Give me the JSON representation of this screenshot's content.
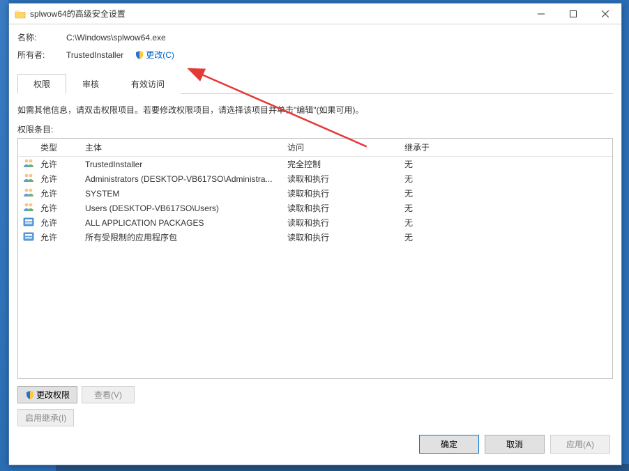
{
  "window": {
    "title": "splwow64的高级安全设置"
  },
  "info": {
    "name_label": "名称:",
    "name_value": "C:\\Windows\\splwow64.exe",
    "owner_label": "所有者:",
    "owner_value": "TrustedInstaller",
    "change_link": "更改(C)"
  },
  "tabs": [
    "权限",
    "审核",
    "有效访问"
  ],
  "instruction": "如需其他信息，请双击权限项目。若要修改权限项目，请选择该项目并单击\"编辑\"(如果可用)。",
  "entries_label": "权限条目:",
  "columns": {
    "type": "类型",
    "principal": "主体",
    "access": "访问",
    "inherit": "继承于"
  },
  "rows": [
    {
      "icon": "users",
      "type": "允许",
      "principal": "TrustedInstaller",
      "access": "完全控制",
      "inherit": "无"
    },
    {
      "icon": "users",
      "type": "允许",
      "principal": "Administrators (DESKTOP-VB617SO\\Administra...",
      "access": "读取和执行",
      "inherit": "无"
    },
    {
      "icon": "users",
      "type": "允许",
      "principal": "SYSTEM",
      "access": "读取和执行",
      "inherit": "无"
    },
    {
      "icon": "users",
      "type": "允许",
      "principal": "Users (DESKTOP-VB617SO\\Users)",
      "access": "读取和执行",
      "inherit": "无"
    },
    {
      "icon": "package",
      "type": "允许",
      "principal": "ALL APPLICATION PACKAGES",
      "access": "读取和执行",
      "inherit": "无"
    },
    {
      "icon": "package",
      "type": "允许",
      "principal": "所有受限制的应用程序包",
      "access": "读取和执行",
      "inherit": "无"
    }
  ],
  "buttons": {
    "change_perm": "更改权限",
    "view": "查看(V)",
    "enable_inherit": "启用继承(I)",
    "ok": "确定",
    "cancel": "取消",
    "apply": "应用(A)"
  }
}
